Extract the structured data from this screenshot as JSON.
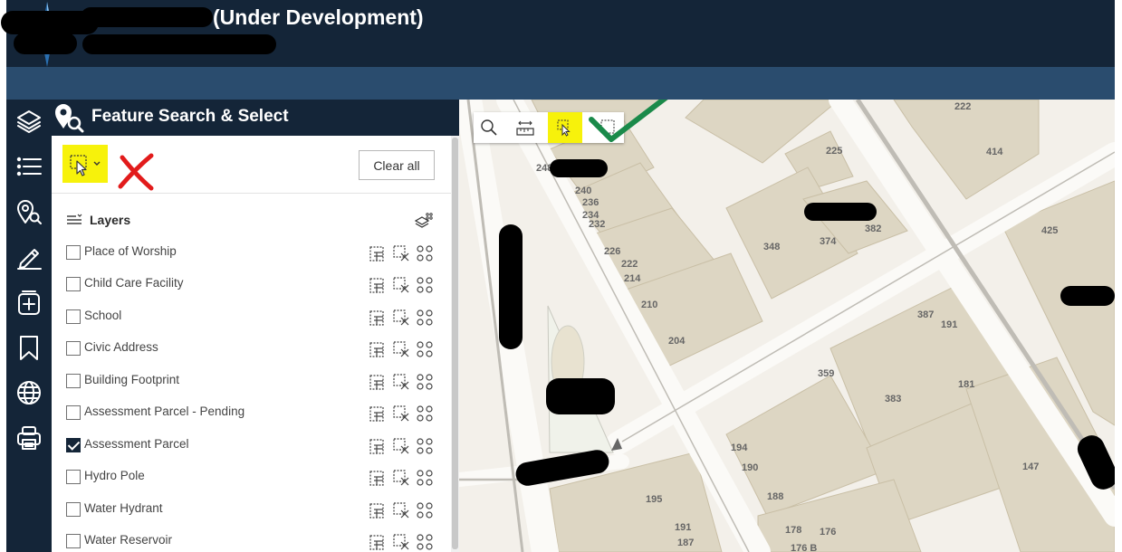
{
  "app": {
    "title": "(Under Development)"
  },
  "panel": {
    "title": "Feature Search & Select",
    "clear_all_label": "Clear all",
    "layers_heading": "Layers",
    "layers": [
      {
        "name": "Place of Worship",
        "checked": false
      },
      {
        "name": "Child Care Facility",
        "checked": false
      },
      {
        "name": "School",
        "checked": false
      },
      {
        "name": "Civic Address",
        "checked": false
      },
      {
        "name": "Building Footprint",
        "checked": false
      },
      {
        "name": "Assessment Parcel - Pending",
        "checked": false
      },
      {
        "name": "Assessment Parcel",
        "checked": true
      },
      {
        "name": "Hydro Pole",
        "checked": false
      },
      {
        "name": "Water Hydrant",
        "checked": false
      },
      {
        "name": "Water Reservoir",
        "checked": false
      }
    ]
  },
  "rail": {
    "icons": [
      "layers-icon",
      "list-icon",
      "feature-search-icon",
      "edit-icon",
      "add-icon",
      "bookmark-icon",
      "globe-icon",
      "print-icon"
    ]
  },
  "map": {
    "parcel_labels": [
      "222",
      "414",
      "225",
      "248",
      "240",
      "236",
      "234",
      "232",
      "374",
      "382",
      "348",
      "425",
      "226",
      "222",
      "214",
      "210",
      "204",
      "387",
      "191",
      "359",
      "383",
      "181",
      "194",
      "190",
      "147",
      "188",
      "195",
      "191",
      "187",
      "178",
      "176",
      "176 B"
    ]
  },
  "colors": {
    "header": "#142538",
    "subbar": "#2a4c6e",
    "highlight": "#f7f20b",
    "annotation_red": "#e21b1b",
    "annotation_green": "#1a8a4a"
  }
}
